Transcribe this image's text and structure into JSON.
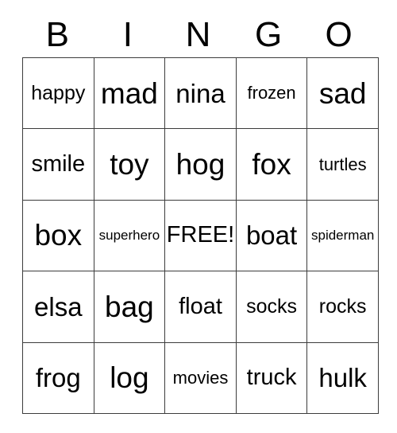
{
  "card": {
    "title": "BINGO",
    "header_letters": [
      "B",
      "I",
      "N",
      "G",
      "O"
    ],
    "free_space_label": "FREE!",
    "free_space_position": {
      "row": 3,
      "column": 3
    },
    "grid_size": "5x5",
    "colors": {
      "background": "#ffffff",
      "border": "#3c3c3c",
      "text": "#000000"
    },
    "columns": [
      {
        "letter": "B",
        "cells": [
          "happy",
          "smile",
          "box",
          "elsa",
          "frog"
        ]
      },
      {
        "letter": "I",
        "cells": [
          "mad",
          "toy",
          "superhero",
          "bag",
          "log"
        ]
      },
      {
        "letter": "N",
        "cells": [
          "nina",
          "hog",
          "FREE!",
          "float",
          "movies"
        ]
      },
      {
        "letter": "G",
        "cells": [
          "frozen",
          "fox",
          "boat",
          "socks",
          "truck"
        ]
      },
      {
        "letter": "O",
        "cells": [
          "sad",
          "turtles",
          "spiderman",
          "rocks",
          "hulk"
        ]
      }
    ],
    "rows": [
      {
        "cells": [
          "happy",
          "mad",
          "nina",
          "frozen",
          "sad"
        ]
      },
      {
        "cells": [
          "smile",
          "toy",
          "hog",
          "fox",
          "turtles"
        ]
      },
      {
        "cells": [
          "box",
          "superhero",
          "FREE!",
          "boat",
          "spiderman"
        ]
      },
      {
        "cells": [
          "elsa",
          "bag",
          "float",
          "socks",
          "rocks"
        ]
      },
      {
        "cells": [
          "frog",
          "log",
          "movies",
          "truck",
          "hulk"
        ]
      }
    ],
    "text_sizes": [
      [
        "fs-m",
        "fs-xxl",
        "fs-xl",
        "fs-s",
        "fs-xxl"
      ],
      [
        "fs-l",
        "fs-xxl",
        "fs-xxl",
        "fs-xxl",
        "fs-s"
      ],
      [
        "fs-xxl",
        "fs-xs",
        "fs-l",
        "fs-xl",
        "fs-xs"
      ],
      [
        "fs-xl",
        "fs-xxl",
        "fs-l",
        "fs-m",
        "fs-m"
      ],
      [
        "fs-xl",
        "fs-xxl",
        "fs-s",
        "fs-l",
        "fs-xl"
      ]
    ]
  }
}
